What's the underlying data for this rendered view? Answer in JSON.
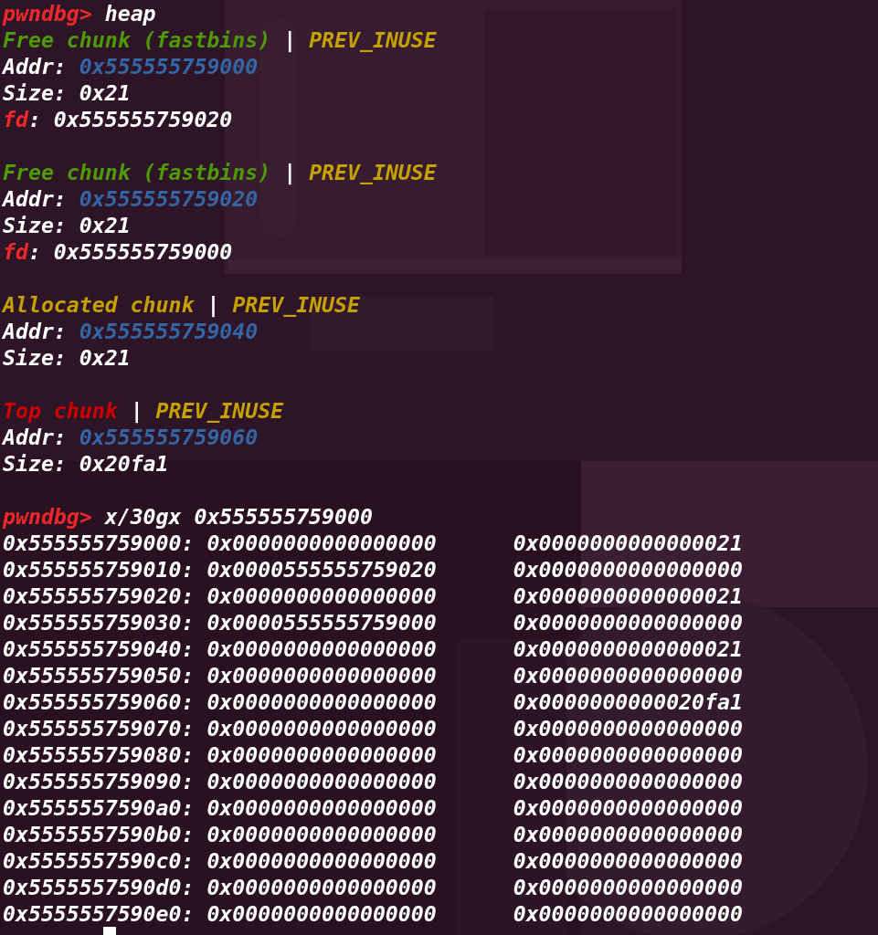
{
  "commands": [
    {
      "prompt": "pwndbg>",
      "command": "heap"
    },
    {
      "prompt": "pwndbg>",
      "command": "x/30gx 0x555555759000"
    }
  ],
  "chunks": [
    {
      "kind": "free",
      "label": "Free chunk (fastbins)",
      "separator": "|",
      "flag": "PREV_INUSE",
      "fields": [
        {
          "kind": "addr",
          "name": "Addr:",
          "value": "0x555555759000"
        },
        {
          "kind": "plain",
          "name": "Size:",
          "value": "0x21"
        },
        {
          "kind": "pointer",
          "name": "fd",
          "value": ": 0x555555759020"
        }
      ]
    },
    {
      "kind": "free",
      "label": "Free chunk (fastbins)",
      "separator": "|",
      "flag": "PREV_INUSE",
      "fields": [
        {
          "kind": "addr",
          "name": "Addr:",
          "value": "0x555555759020"
        },
        {
          "kind": "plain",
          "name": "Size:",
          "value": "0x21"
        },
        {
          "kind": "pointer",
          "name": "fd",
          "value": ": 0x555555759000"
        }
      ]
    },
    {
      "kind": "allocated",
      "label": "Allocated chunk",
      "separator": "|",
      "flag": "PREV_INUSE",
      "fields": [
        {
          "kind": "addr",
          "name": "Addr:",
          "value": "0x555555759040"
        },
        {
          "kind": "plain",
          "name": "Size:",
          "value": "0x21"
        }
      ]
    },
    {
      "kind": "top",
      "label": "Top chunk",
      "separator": "|",
      "flag": "PREV_INUSE",
      "fields": [
        {
          "kind": "addr",
          "name": "Addr:",
          "value": "0x555555759060"
        },
        {
          "kind": "plain",
          "name": "Size:",
          "value": "0x20fa1"
        }
      ]
    }
  ],
  "memory": [
    {
      "address": "0x555555759000:",
      "word_1": "0x0000000000000000",
      "word_2": "0x0000000000000021"
    },
    {
      "address": "0x555555759010:",
      "word_1": "0x0000555555759020",
      "word_2": "0x0000000000000000"
    },
    {
      "address": "0x555555759020:",
      "word_1": "0x0000000000000000",
      "word_2": "0x0000000000000021"
    },
    {
      "address": "0x555555759030:",
      "word_1": "0x0000555555759000",
      "word_2": "0x0000000000000000"
    },
    {
      "address": "0x555555759040:",
      "word_1": "0x0000000000000000",
      "word_2": "0x0000000000000021"
    },
    {
      "address": "0x555555759050:",
      "word_1": "0x0000000000000000",
      "word_2": "0x0000000000000000"
    },
    {
      "address": "0x555555759060:",
      "word_1": "0x0000000000000000",
      "word_2": "0x0000000000020fa1"
    },
    {
      "address": "0x555555759070:",
      "word_1": "0x0000000000000000",
      "word_2": "0x0000000000000000"
    },
    {
      "address": "0x555555759080:",
      "word_1": "0x0000000000000000",
      "word_2": "0x0000000000000000"
    },
    {
      "address": "0x555555759090:",
      "word_1": "0x0000000000000000",
      "word_2": "0x0000000000000000"
    },
    {
      "address": "0x5555557590a0:",
      "word_1": "0x0000000000000000",
      "word_2": "0x0000000000000000"
    },
    {
      "address": "0x5555557590b0:",
      "word_1": "0x0000000000000000",
      "word_2": "0x0000000000000000"
    },
    {
      "address": "0x5555557590c0:",
      "word_1": "0x0000000000000000",
      "word_2": "0x0000000000000000"
    },
    {
      "address": "0x5555557590d0:",
      "word_1": "0x0000000000000000",
      "word_2": "0x0000000000000000"
    },
    {
      "address": "0x5555557590e0:",
      "word_1": "0x0000000000000000",
      "word_2": "0x0000000000000000"
    }
  ]
}
